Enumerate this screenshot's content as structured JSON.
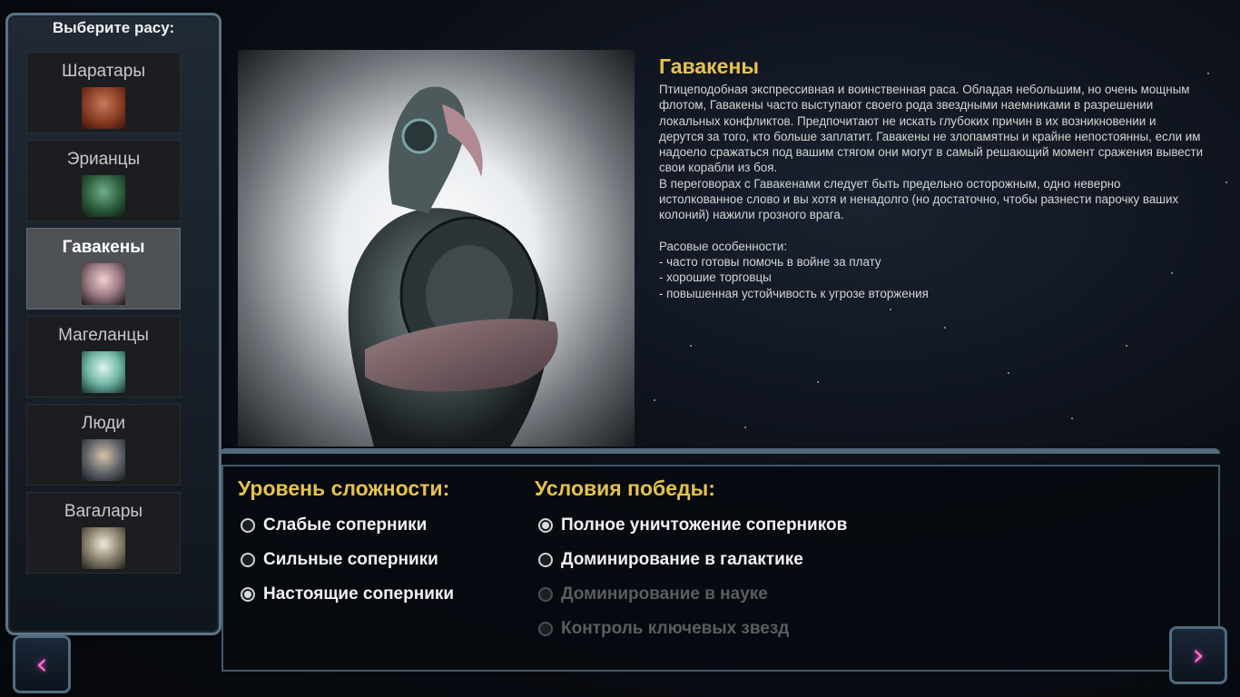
{
  "race_panel": {
    "title": "Выберите расу:",
    "races": [
      {
        "name": "Шаратары",
        "portrait": "sharatar-portrait"
      },
      {
        "name": "Эрианцы",
        "portrait": "erian-portrait"
      },
      {
        "name": "Гавакены",
        "portrait": "gavaken-portrait",
        "selected": true
      },
      {
        "name": "Магеланцы",
        "portrait": "magelan-portrait"
      },
      {
        "name": "Люди",
        "portrait": "human-portrait"
      },
      {
        "name": "Вагалары",
        "portrait": "vagalar-portrait"
      }
    ]
  },
  "selected_race": {
    "title": "Гавакены",
    "description": [
      "Птицеподобная экспрессивная и воинственная раса. Обладая небольшим, но очень мощным флотом, Гавакены часто выступают своего рода звездными наемниками в разрешении локальных конфликтов. Предпочитают не искать глубоких причин в их возникновении и дерутся за того, кто больше заплатит. Гавакены не злопамятны и крайне непостоянны, если им надоело сражаться под вашим стягом они могут в самый решающий момент сражения вывести свои корабли из боя.",
      "В переговорах с Гавакенами следует быть предельно осторожным, одно неверно истолкованное слово и вы хотя и ненадолго (но достаточно, чтобы разнести парочку ваших колоний) нажили грозного врага."
    ],
    "traits_heading": "Расовые особенности:",
    "traits": [
      "- часто готовы помочь в войне за плату",
      "- хорошие торговцы",
      "- повышенная устойчивость к угрозе вторжения"
    ]
  },
  "difficulty": {
    "heading": "Уровень сложности:",
    "options": [
      {
        "label": "Слабые соперники",
        "checked": false,
        "enabled": true
      },
      {
        "label": "Сильные соперники",
        "checked": false,
        "enabled": true
      },
      {
        "label": "Настоящие соперники",
        "checked": true,
        "enabled": true
      }
    ]
  },
  "victory": {
    "heading": "Условия победы:",
    "options": [
      {
        "label": "Полное уничтожение соперников",
        "checked": true,
        "enabled": true
      },
      {
        "label": "Доминирование в галактике",
        "checked": false,
        "enabled": true
      },
      {
        "label": "Доминирование в науке",
        "checked": false,
        "enabled": false
      },
      {
        "label": "Контроль ключевых звезд",
        "checked": false,
        "enabled": false
      }
    ]
  },
  "nav": {
    "prev_icon": "chevron-left-icon",
    "next_icon": "chevron-right-icon",
    "prev_glyph": "‹",
    "next_glyph": "›"
  },
  "colors": {
    "accent": "#e6c24e",
    "frame": "#5c7486",
    "selected_bg": "#4e5155"
  }
}
